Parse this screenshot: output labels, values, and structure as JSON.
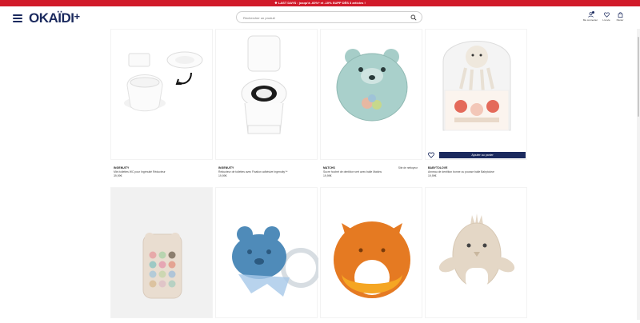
{
  "promo": {
    "text": "❖ LAST DAYS : jusqu'à -60%* et -10% SUPP DÈS 3 articles !"
  },
  "header": {
    "logo": "OKAÏDI",
    "logo_plus": "+",
    "search_placeholder": "Rechercher un produit",
    "account_label": "Me connecter",
    "wishlist_label": "L'envie",
    "cart_label": "Panier"
  },
  "products": [
    {
      "brand": "INGENUITY",
      "name": "Mini toilettes WC pour Ingénuité Réducteur",
      "price": "39,99€",
      "badge": ""
    },
    {
      "brand": "INGENUITY",
      "name": "Réducteur de toilettes avec Fixation adhésive Ingenuity™",
      "price": "19,99€",
      "badge": ""
    },
    {
      "brand": "MATCHS",
      "name": "Sucre hochet de dentition vert avec balle Matchs",
      "price": "19,99€",
      "badge": "Site de nettoyeur"
    },
    {
      "brand": "BABYTOLOVE",
      "name": "Anneau de dentition bonne ou pousse balle Babytolove",
      "price": "19,99€",
      "badge": ""
    },
    {
      "brand": "",
      "name": "",
      "price": "",
      "badge": ""
    },
    {
      "brand": "",
      "name": "",
      "price": "",
      "badge": ""
    },
    {
      "brand": "",
      "name": "",
      "price": "",
      "badge": ""
    },
    {
      "brand": "",
      "name": "",
      "price": "",
      "badge": ""
    }
  ],
  "add_to_cart_label": "Ajouter au panier",
  "colors": {
    "brand": "#1b2a5e",
    "promo": "#d11a2a"
  }
}
